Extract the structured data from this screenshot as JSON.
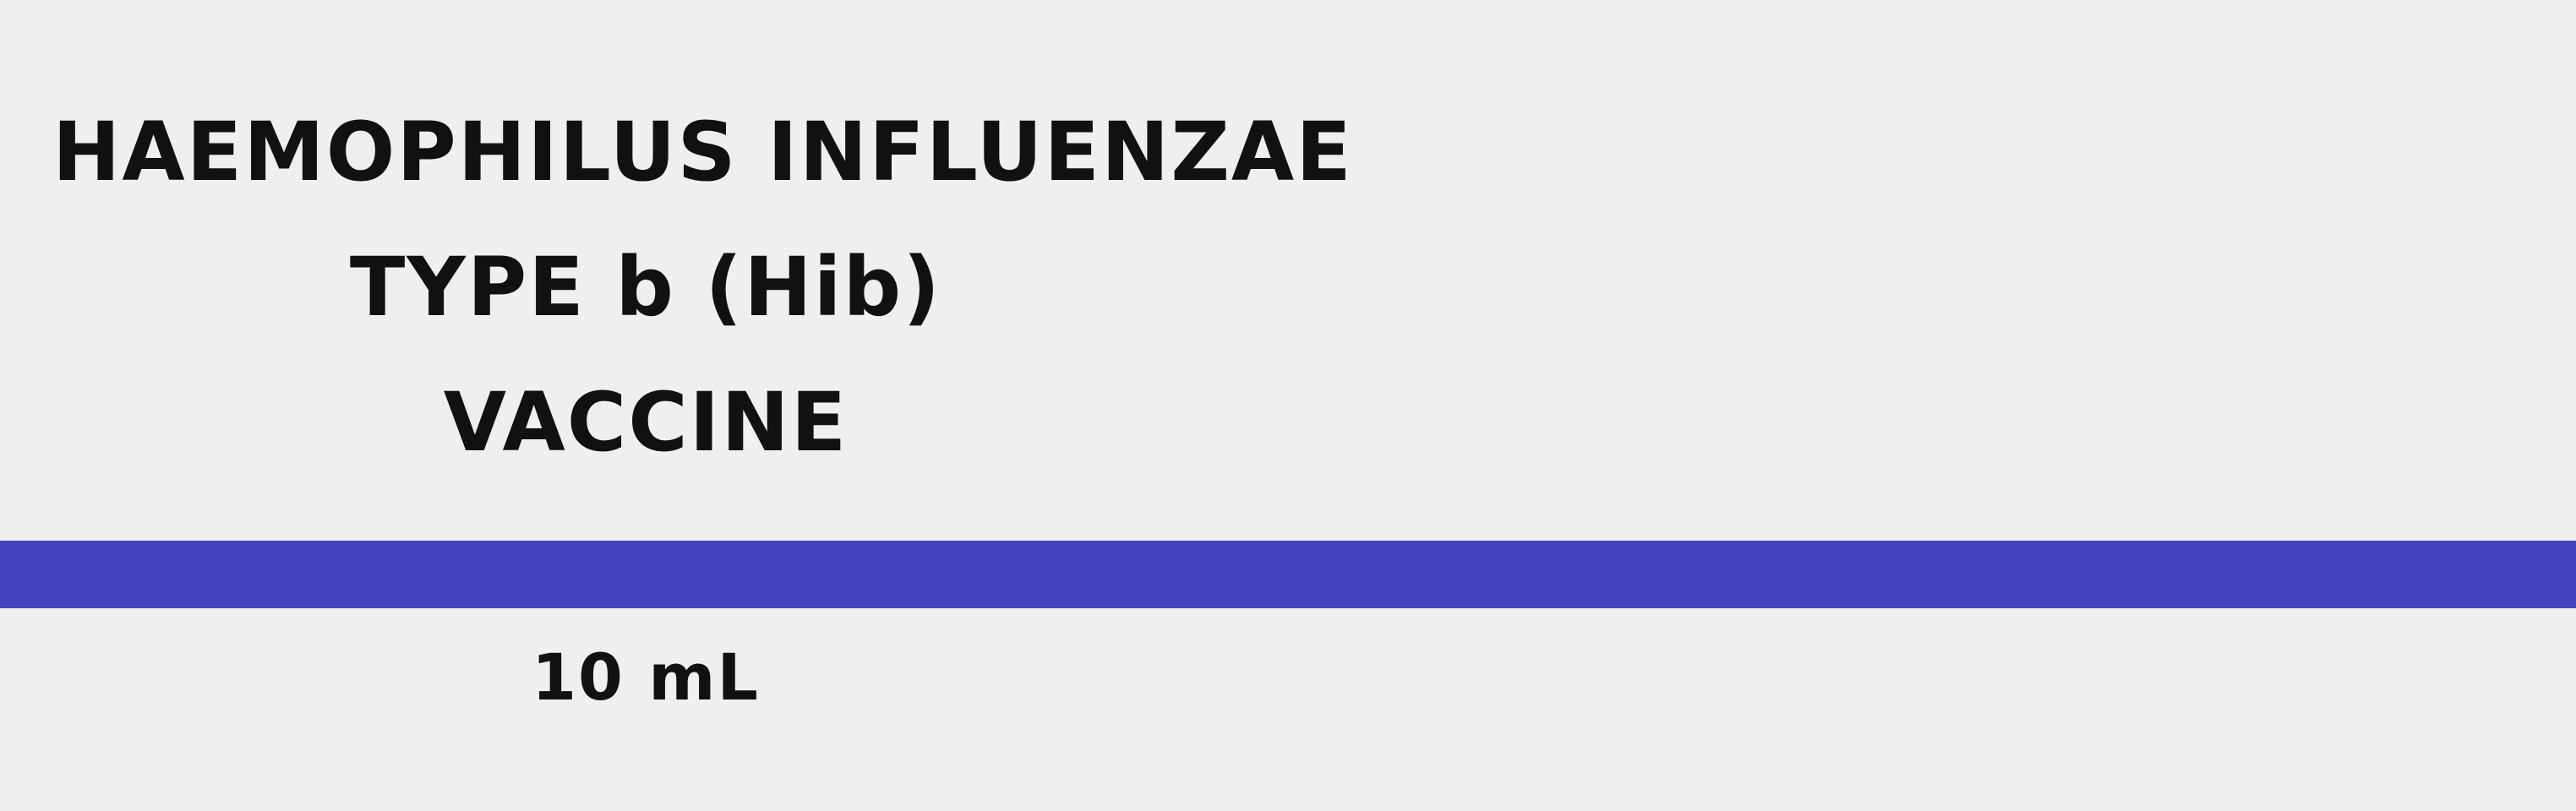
{
  "label": {
    "title_lines": [
      "HAEMOPHILUS INFLUENZAE",
      "TYPE b (Hib)",
      "VACCINE"
    ],
    "volume": "10 mL"
  },
  "colors": {
    "background": "#efefef",
    "band": "#4343bf",
    "text": "#111111"
  }
}
